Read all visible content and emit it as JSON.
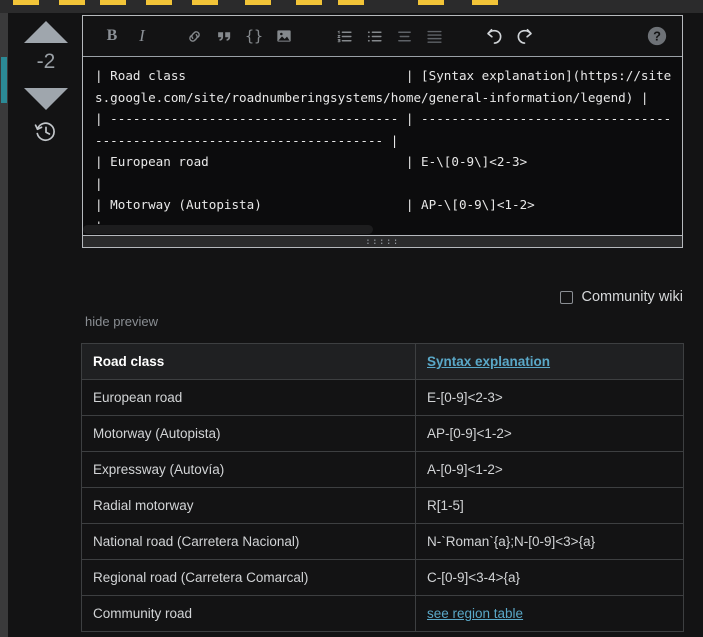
{
  "top_markers": {
    "count": 10,
    "color": "#f2c438",
    "positions": [
      38,
      178,
      300,
      438,
      575,
      735,
      888,
      1015,
      1255,
      1415
    ]
  },
  "vote": {
    "upvote_name": "upvote",
    "score": "-2",
    "downvote_name": "downvote",
    "history_name": "revision-history"
  },
  "toolbar": {
    "bold": "B",
    "italic": "I",
    "link": "link",
    "blockquote": "blockquote",
    "code": "{}",
    "image": "image",
    "numbered_list": "numbered-list",
    "bulleted_list": "bulleted-list",
    "heading": "heading",
    "horizontal_rule": "horizontal-rule",
    "undo": "undo",
    "redo": "redo",
    "help": "?"
  },
  "editor": {
    "content": "| Road class                             | [Syntax explanation](https://sites.google.com/site/roadnumberingsystems/home/general-information/legend) |\n| -------------------------------------- | ----------------------------------------------------------------------- |\n| European road                          | E-\\[0-9\\]<2-3>                                                           |\n| Motorway (Autopista)                   | AP-\\[0-9\\]<1-2>                                                          |\n|"
  },
  "community_wiki": {
    "label": "Community wiki",
    "checked": false
  },
  "preview": {
    "toggle_label": "hide preview",
    "table": {
      "headers": [
        "Road class",
        "Syntax explanation"
      ],
      "header_link": "Syntax explanation",
      "rows": [
        {
          "road_class": "European road",
          "syntax": "E-[0-9]<2-3>",
          "syntax_is_link": false
        },
        {
          "road_class": "Motorway (Autopista)",
          "syntax": "AP-[0-9]<1-2>",
          "syntax_is_link": false
        },
        {
          "road_class": "Expressway (Autovía)",
          "syntax": "A-[0-9]<1-2>",
          "syntax_is_link": false
        },
        {
          "road_class": "Radial motorway",
          "syntax": "R[1-5]",
          "syntax_is_link": false
        },
        {
          "road_class": "National road (Carretera Nacional)",
          "syntax": "N-`Roman`{a};N-[0-9]<3>{a}",
          "syntax_is_link": false
        },
        {
          "road_class": "Regional road (Carretera Comarcal)",
          "syntax": "C-[0-9]<3-4>{a}",
          "syntax_is_link": false
        },
        {
          "road_class": "Community road",
          "syntax": "see region table",
          "syntax_is_link": true
        }
      ]
    }
  },
  "colors": {
    "background": "#131314",
    "accent_teal": "#1fd1a5",
    "link": "#5aa8c8",
    "marker_yellow": "#f2c438",
    "scroll_teal": "#2b8a96"
  }
}
